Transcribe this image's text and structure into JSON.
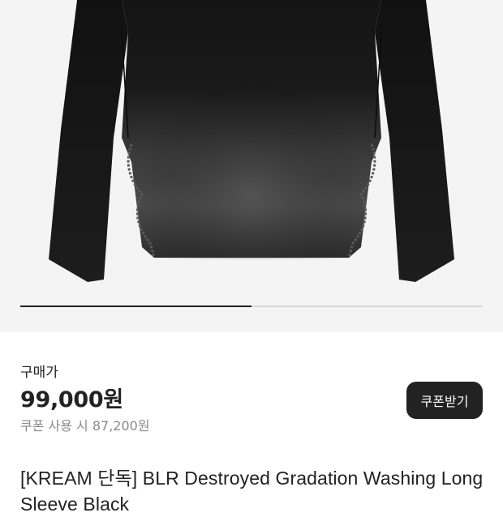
{
  "gallery": {
    "image_alt": "BLR Destroyed Gradation Washing Long Sleeve Black",
    "slide_progress": 0.5
  },
  "pricing": {
    "label": "구매가",
    "price": "99,000원",
    "coupon_price": "쿠폰 사용 시 87,200원",
    "coupon_button_label": "쿠폰받기"
  },
  "product": {
    "title": "[KREAM 단독] BLR Destroyed Gradation Washing Long Sleeve Black"
  },
  "colors": {
    "background_gallery": "#f4f4f4",
    "primary_text": "#222222",
    "muted_text": "#8a8a8a",
    "button_background": "#222222",
    "button_text": "#ffffff"
  }
}
